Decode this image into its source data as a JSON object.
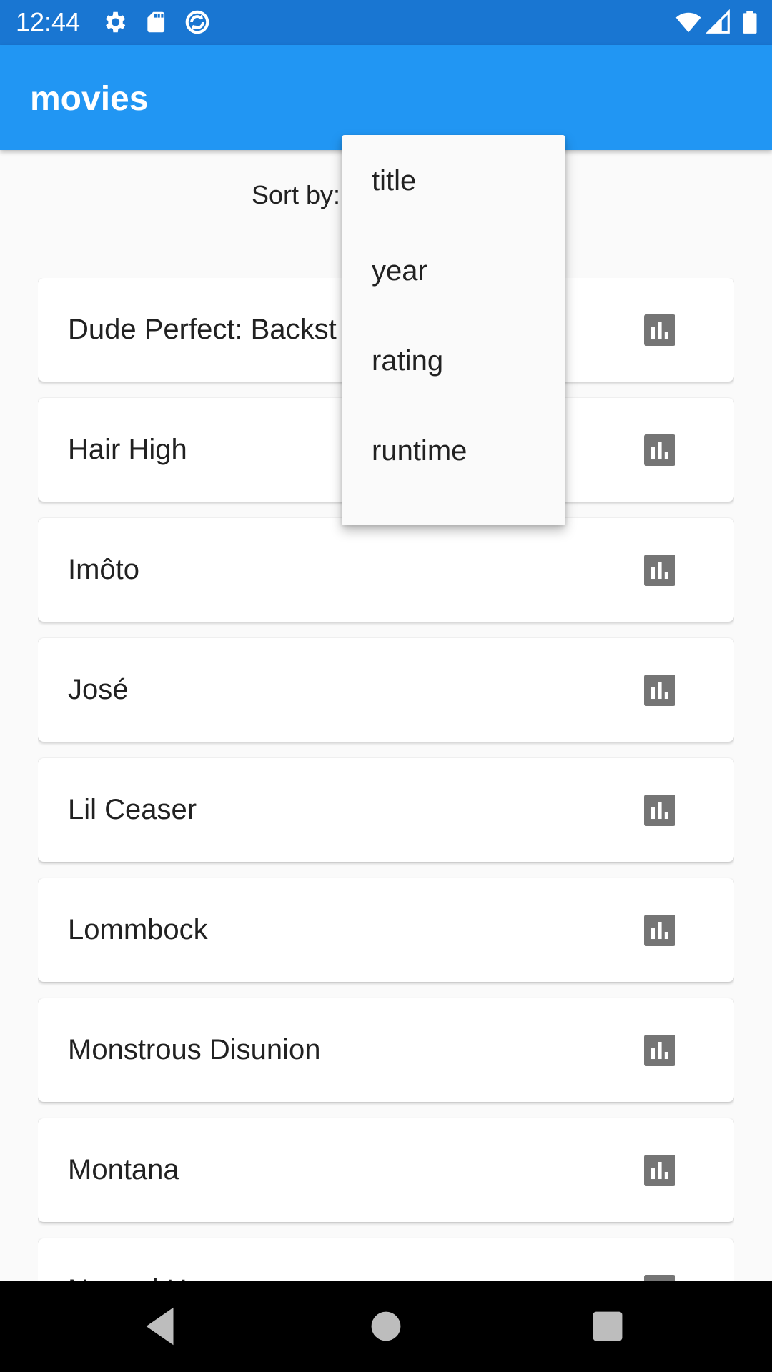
{
  "status_bar": {
    "time": "12:44",
    "left_icons": [
      "settings-icon",
      "sd-card-icon",
      "sync-icon"
    ],
    "right_icons": [
      "wifi-icon",
      "signal-icon",
      "battery-icon"
    ]
  },
  "app_bar": {
    "title": "movies",
    "color": "#2196f3"
  },
  "sort": {
    "label": "Sort by:",
    "options": [
      "title",
      "year",
      "rating",
      "runtime"
    ]
  },
  "movies": [
    {
      "title": "Dude Perfect: Backst"
    },
    {
      "title": "Hair High"
    },
    {
      "title": "Imôto"
    },
    {
      "title": "José"
    },
    {
      "title": "Lil Ceaser"
    },
    {
      "title": "Lommbock"
    },
    {
      "title": "Monstrous Disunion"
    },
    {
      "title": "Montana"
    },
    {
      "title": "Nammi Ho"
    }
  ],
  "card_icon": "bar-chart-icon",
  "nav_bar": [
    "back-icon",
    "home-icon",
    "recents-icon"
  ]
}
